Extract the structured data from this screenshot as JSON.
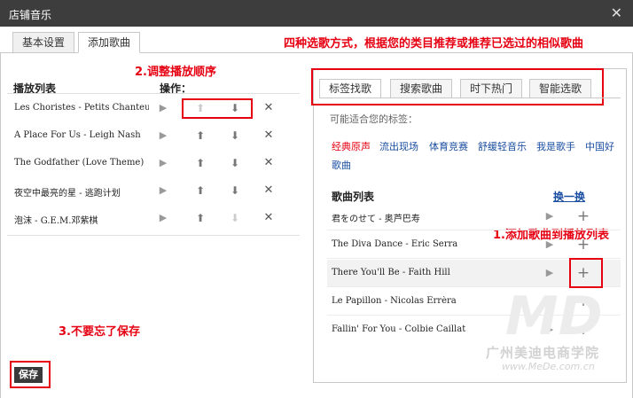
{
  "window": {
    "title": "店铺音乐",
    "close_label": "✕"
  },
  "main_tabs": [
    {
      "label": "基本设置",
      "active": false
    },
    {
      "label": "添加歌曲",
      "active": true
    }
  ],
  "annotations": {
    "top": "四种选歌方式，根据您的类目推荐或推荐已选过的相似歌曲",
    "reorder": "2.调整播放顺序",
    "add": "1.添加歌曲到播放列表",
    "save": "3.不要忘了保存"
  },
  "playlist": {
    "header": "播放列表",
    "ops_header": "操作：",
    "items": [
      {
        "title": "Les Choristes - Petits Chanteurs",
        "up_disabled": true,
        "down_disabled": false
      },
      {
        "title": "A Place For Us - Leigh Nash",
        "up_disabled": false,
        "down_disabled": false
      },
      {
        "title": "The Godfather (Love Theme)",
        "up_disabled": false,
        "down_disabled": false
      },
      {
        "title": "夜空中最亮的星 - 逃跑计划",
        "up_disabled": false,
        "down_disabled": false
      },
      {
        "title": "泡沫 - G.E.M.邓紫棋",
        "up_disabled": false,
        "down_disabled": true
      }
    ]
  },
  "sub_tabs": [
    {
      "label": "标签找歌",
      "active": true
    },
    {
      "label": "搜索歌曲",
      "active": false
    },
    {
      "label": "时下热门",
      "active": false
    },
    {
      "label": "智能选歌",
      "active": false
    }
  ],
  "tags": {
    "hint": "可能适合您的标签：",
    "items": [
      {
        "label": "经典原声",
        "active": true
      },
      {
        "label": "流出现场",
        "active": false
      },
      {
        "label": "体育竞赛",
        "active": false
      },
      {
        "label": "舒缓轻音乐",
        "active": false
      },
      {
        "label": "我是歌手",
        "active": false
      },
      {
        "label": "中国好",
        "active": false
      },
      {
        "label": "歌曲",
        "active": false
      }
    ]
  },
  "song_list": {
    "header": "歌曲列表",
    "refresh": "换一换",
    "items": [
      {
        "title": "君をのせて - 奥芦巴寿"
      },
      {
        "title": "The Diva Dance - Eric Serra"
      },
      {
        "title": "There You'll Be  - Faith Hill"
      },
      {
        "title": "Le Papillon  - Nicolas Errèra"
      },
      {
        "title": "Fallin' For You - Colbie Caillat"
      }
    ]
  },
  "watermark": {
    "text": "广州美迪电商学院",
    "url": "www.MeDe.com.cn",
    "logo": "MD"
  },
  "save_button": "保存",
  "icons": {
    "play": "play-icon",
    "up": "arrow-up-icon",
    "down": "arrow-down-icon",
    "delete": "close-icon",
    "add": "plus-icon"
  }
}
